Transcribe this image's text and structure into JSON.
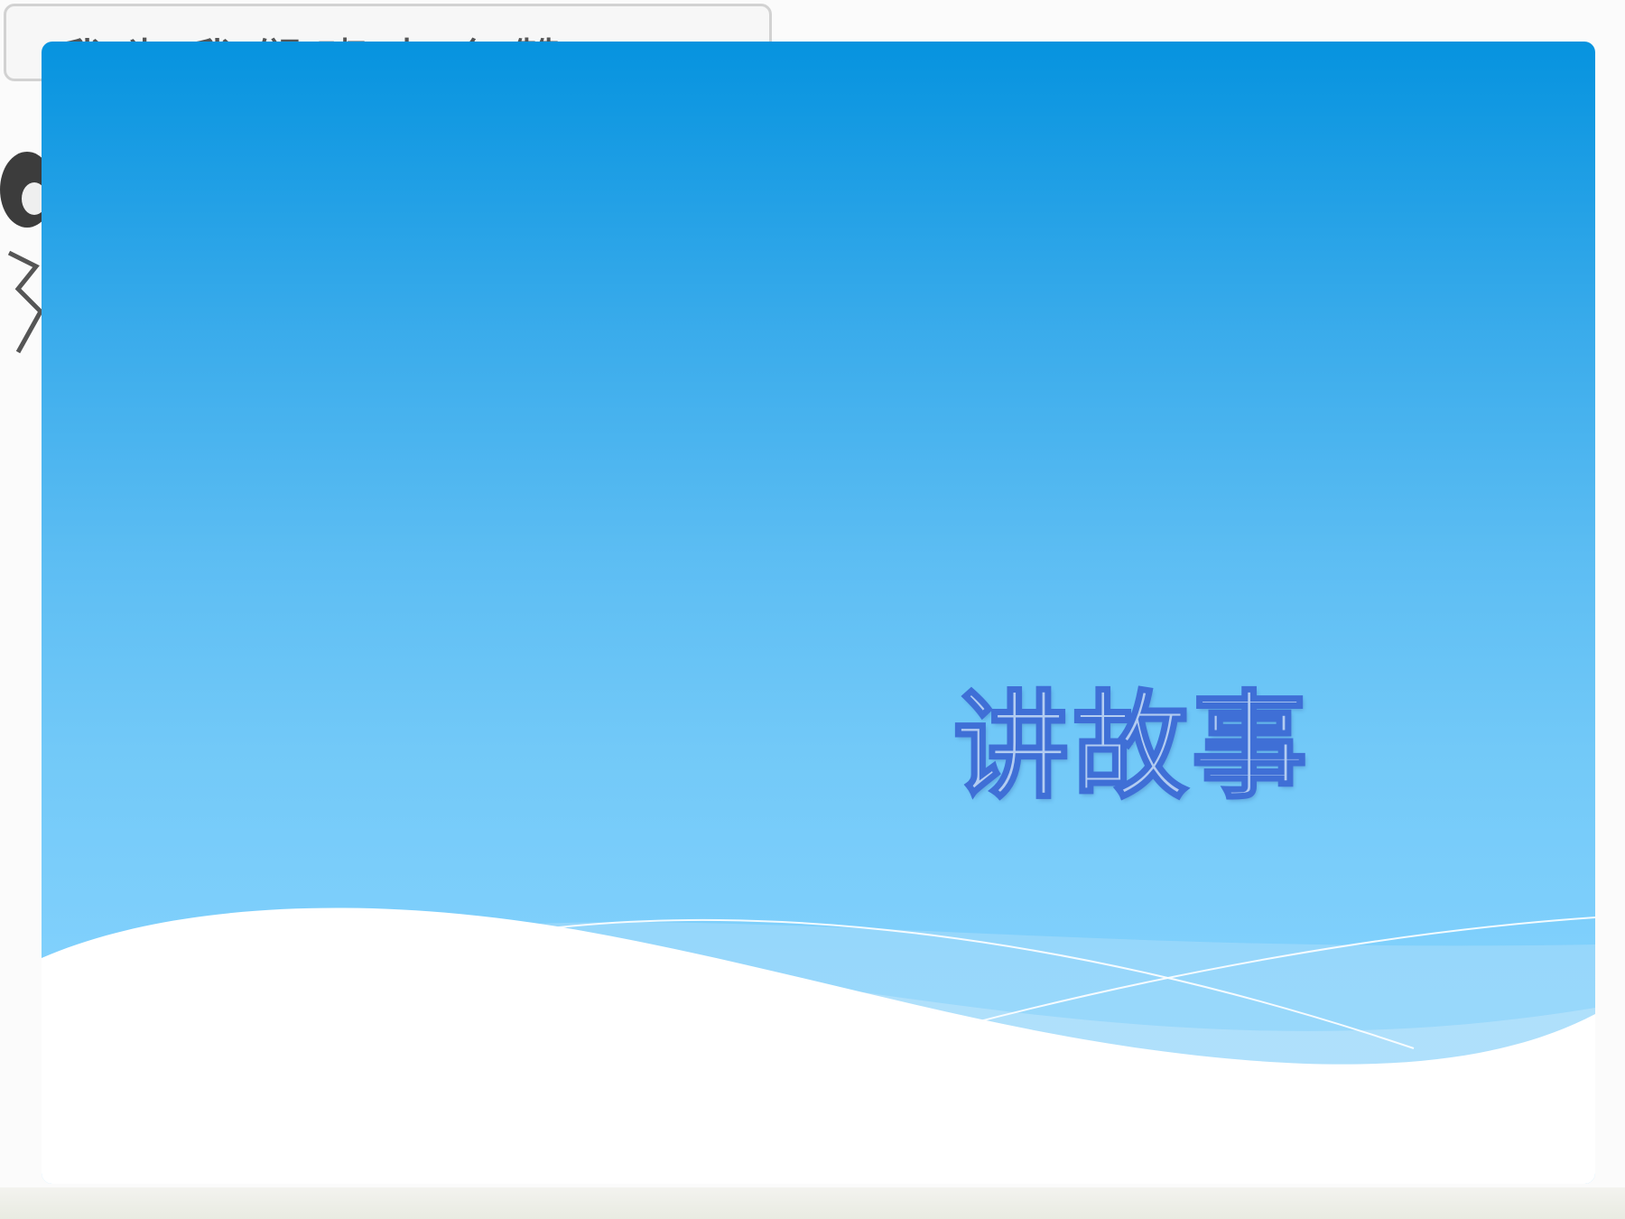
{
  "background_scan": {
    "header_text": "我为我们班点个赞"
  },
  "slide": {
    "title": "讲故事"
  },
  "colors": {
    "gradient_top": "#0693df",
    "gradient_bottom": "#86d3fd",
    "title_fill": "#b3ccf1",
    "title_outline": "#3f6fd6"
  }
}
